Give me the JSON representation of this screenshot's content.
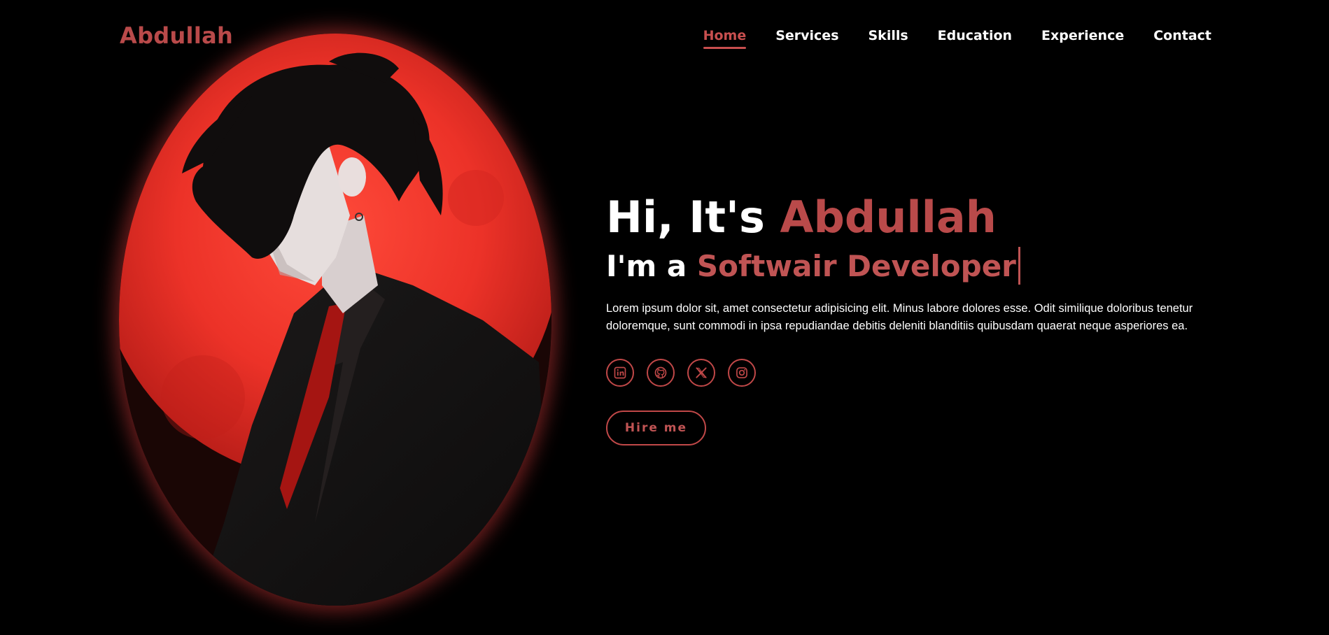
{
  "header": {
    "logo": "Abdullah",
    "nav": [
      {
        "label": "Home",
        "active": true
      },
      {
        "label": "Services",
        "active": false
      },
      {
        "label": "Skills",
        "active": false
      },
      {
        "label": "Education",
        "active": false
      },
      {
        "label": "Experience",
        "active": false
      },
      {
        "label": "Contact",
        "active": false
      }
    ]
  },
  "hero": {
    "greeting_prefix": "Hi, It's",
    "greeting_name": "Abdullah",
    "role_prefix": "I'm a",
    "role_title": "Softwair Developer",
    "description": "Lorem ipsum dolor sit, amet consectetur adipisicing elit. Minus labore dolores esse. Odit similique doloribus tenetur doloremque, sunt commodi in ipsa repudiandae debitis deleniti blanditiis quibusdam quaerat neque asperiores ea.",
    "socials": [
      {
        "name": "linkedin-icon"
      },
      {
        "name": "github-icon"
      },
      {
        "name": "x-twitter-icon"
      },
      {
        "name": "instagram-icon"
      }
    ],
    "hire_label": "Hire me"
  },
  "colors": {
    "accent": "#b94a4a",
    "background": "#000000",
    "moon": "#e8302a"
  }
}
